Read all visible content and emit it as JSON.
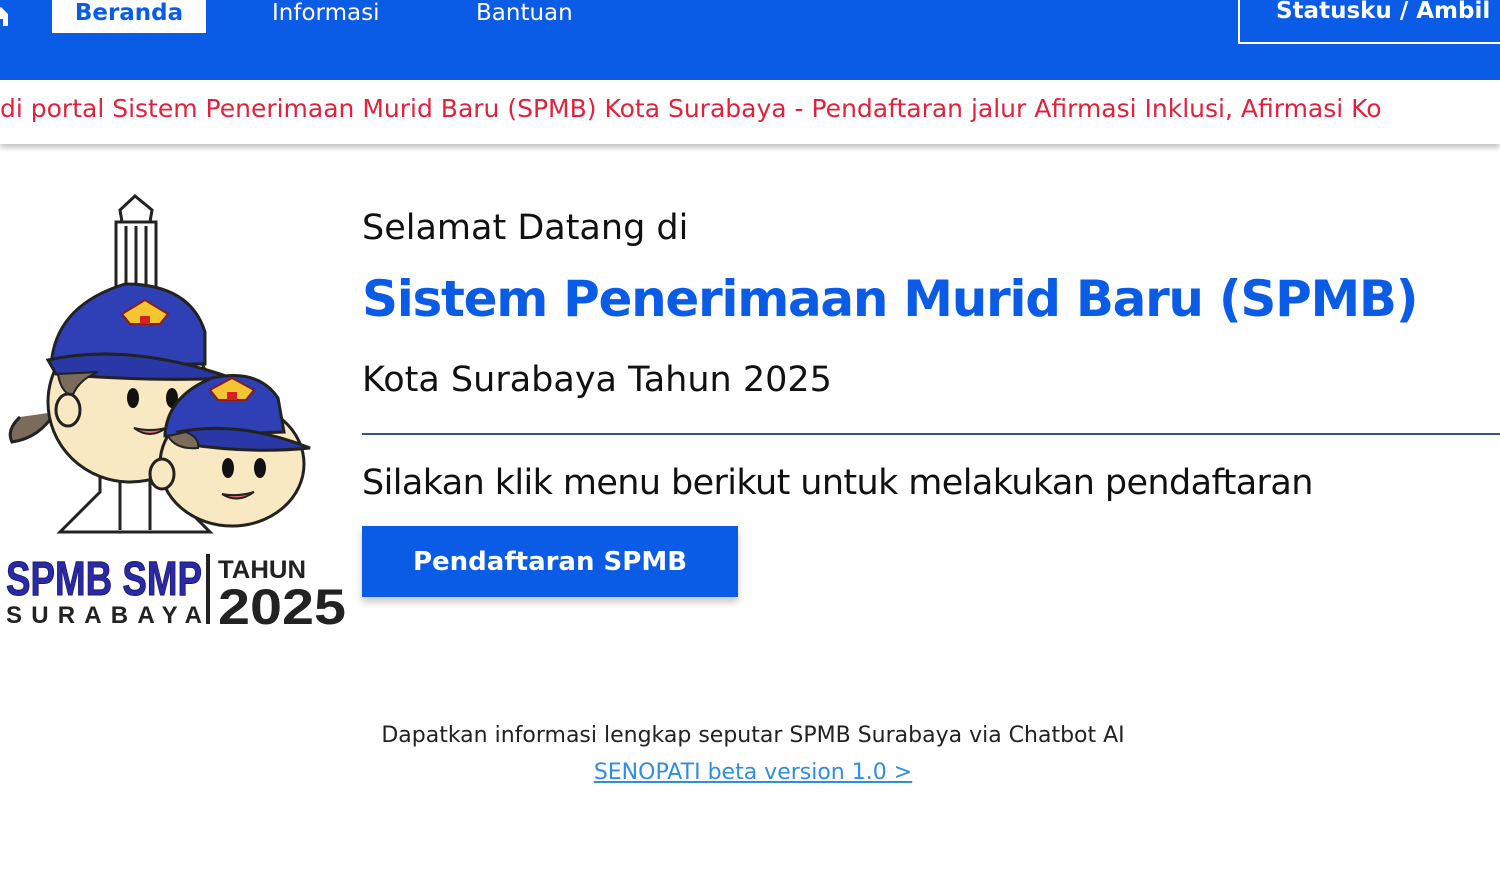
{
  "nav": {
    "tabs": [
      "Beranda",
      "Informasi",
      "Bantuan"
    ],
    "status_button": "Statusku / Ambil P"
  },
  "ticker": "di portal Sistem Penerimaan Murid Baru (SPMB) Kota Surabaya - Pendaftaran jalur Afirmasi Inklusi, Afirmasi Ko",
  "logo": {
    "line1": "SPMB SMP",
    "line2": "SURABAYA",
    "year_label": "TAHUN",
    "year": "2025"
  },
  "hero": {
    "welcome": "Selamat Datang di",
    "title": "Sistem Penerimaan Murid Baru (SPMB)",
    "subtitle": "Kota Surabaya Tahun 2025",
    "instruction": "Silakan klik menu berikut untuk melakukan pendaftaran",
    "button": "Pendaftaran SPMB"
  },
  "chatbot": {
    "text": "Dapatkan informasi lengkap seputar SPMB Surabaya via Chatbot AI",
    "link": "SENOPATI beta version 1.0 >"
  },
  "colors": {
    "primary": "#0a5ce6",
    "ticker_text": "#e0233a",
    "link": "#2f8ee0",
    "logo_text": "#2a2aa8"
  },
  "icons": [
    "home-icon",
    "emblem-icon"
  ]
}
